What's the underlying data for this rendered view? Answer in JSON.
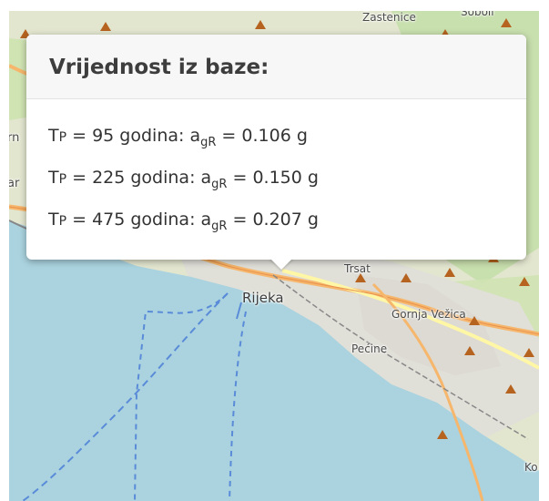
{
  "map": {
    "labels": {
      "zastenice": "Zastenice",
      "sobol": "Soboli",
      "rn": "rn",
      "ar": "ar",
      "trsat": "Trsat",
      "rijeka": "Rijeka",
      "gornja_vezica": "Gornja Vežica",
      "pecine": "Pećine",
      "ko": "Ko"
    },
    "colors": {
      "sea": "#aad3df",
      "land": "#eaebd6",
      "urban": "#e0dfd8",
      "forest": "#c8dfae",
      "road_primary": "#f6b66b",
      "road_secondary": "#fff6a6",
      "ferry": "#5a8bd8",
      "peak": "#b5631f"
    }
  },
  "popup": {
    "title": "Vrijednost iz baze:",
    "rows": [
      {
        "tp_label": "T",
        "tp_sub": "P",
        "prefix": " = ",
        "years": " 95",
        "unit": " godina: a",
        "ag_sub": "gR",
        "equals": " = ",
        "value": "0.106",
        "value_unit": " g"
      },
      {
        "tp_label": "T",
        "tp_sub": "P",
        "prefix": " = ",
        "years": "225",
        "unit": " godina: a",
        "ag_sub": "gR",
        "equals": " = ",
        "value": "0.150",
        "value_unit": " g"
      },
      {
        "tp_label": "T",
        "tp_sub": "P",
        "prefix": " = ",
        "years": "475",
        "unit": " godina: a",
        "ag_sub": "gR",
        "equals": " = ",
        "value": "0.207",
        "value_unit": " g"
      }
    ]
  }
}
